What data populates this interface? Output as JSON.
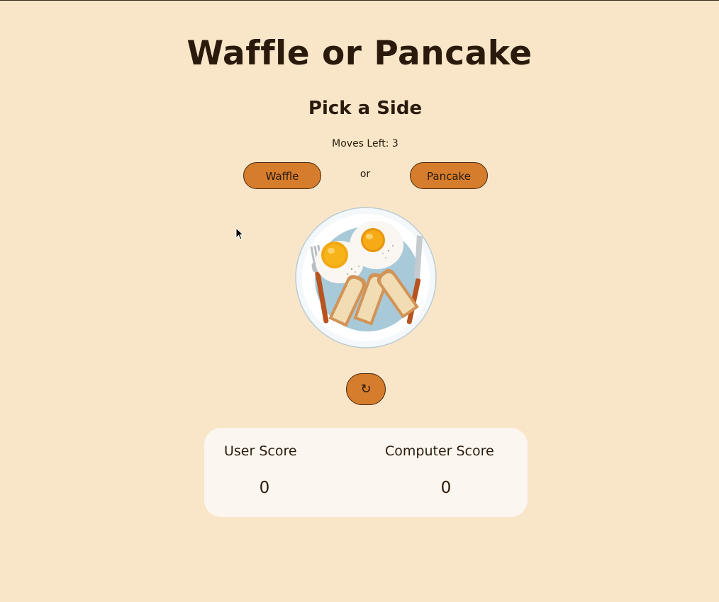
{
  "game": {
    "title": "Waffle or Pancake",
    "subtitle": "Pick a Side",
    "moves_label": "Moves Left: 3",
    "choices": {
      "waffle": "Waffle",
      "or": "or",
      "pancake": "Pancake"
    },
    "reset_icon": "reset-icon",
    "image": "breakfast-plate-image"
  },
  "scoreboard": {
    "user_label": "User Score",
    "user_score": "0",
    "computer_label": "Computer Score",
    "computer_score": "0"
  },
  "colors": {
    "background": "#f9e6c8",
    "button": "#d57d2c",
    "text": "#2a1a0c",
    "panel": "#fbf6ef"
  }
}
